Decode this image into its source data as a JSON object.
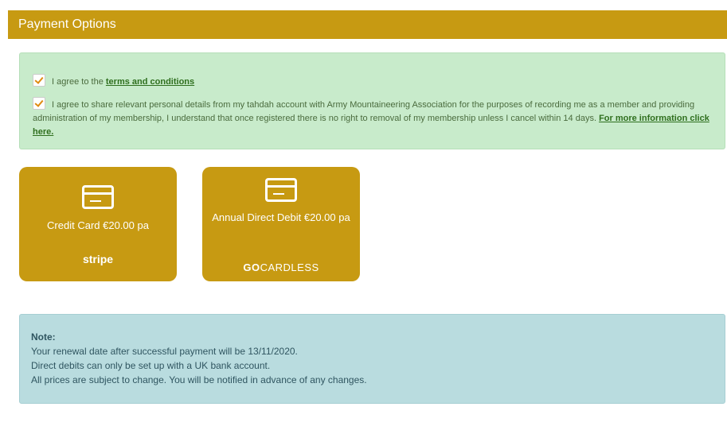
{
  "header": {
    "title": "Payment Options"
  },
  "agreements": {
    "terms_prefix": "I agree to the",
    "terms_link": "terms and conditions",
    "share_text": "I agree to share relevant personal details from my tahdah account with Army Mountaineering Association for the purposes of recording me as a member and providing administration of my membership, I understand that once registered there is no right to removal of my membership unless I cancel within 14 days.",
    "more_info_link": "For more information click here."
  },
  "payment_options": [
    {
      "label": "Credit Card €20.00 pa",
      "brand": "stripe"
    },
    {
      "label": "Annual Direct Debit €20.00 pa",
      "brand_bold": "GO",
      "brand_rest": "CARDLESS"
    }
  ],
  "note": {
    "title": "Note:",
    "lines": [
      "Your renewal date after successful payment will be 13/11/2020.",
      "Direct debits can only be set up with a UK bank account.",
      "All prices are subject to change. You will be notified in advance of any changes."
    ]
  },
  "colors": {
    "accent": "#c79a12",
    "success_bg": "#c8ebcb",
    "info_bg": "#b9dcdf"
  }
}
